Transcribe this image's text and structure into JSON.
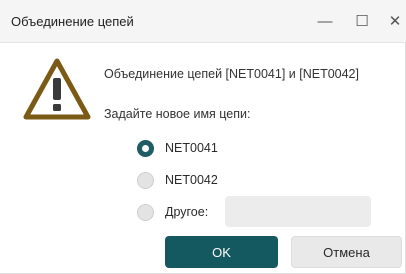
{
  "window": {
    "title": "Объединение цепей",
    "minimize_glyph": "—",
    "maximize_glyph": "☐",
    "close_glyph": "✕"
  },
  "dialog": {
    "icon": "warning-icon",
    "message": "Объединение цепей [NET0041] и [NET0042]",
    "prompt": "Задайте новое имя цепи:",
    "options": [
      {
        "label": "NET0041",
        "checked": true
      },
      {
        "label": "NET0042",
        "checked": false
      },
      {
        "label": "Другое:",
        "checked": false
      }
    ],
    "other_value": "",
    "ok_label": "OK",
    "cancel_label": "Отмена"
  },
  "colors": {
    "accent": "#14595f",
    "warning_stroke": "#7a5a14"
  }
}
